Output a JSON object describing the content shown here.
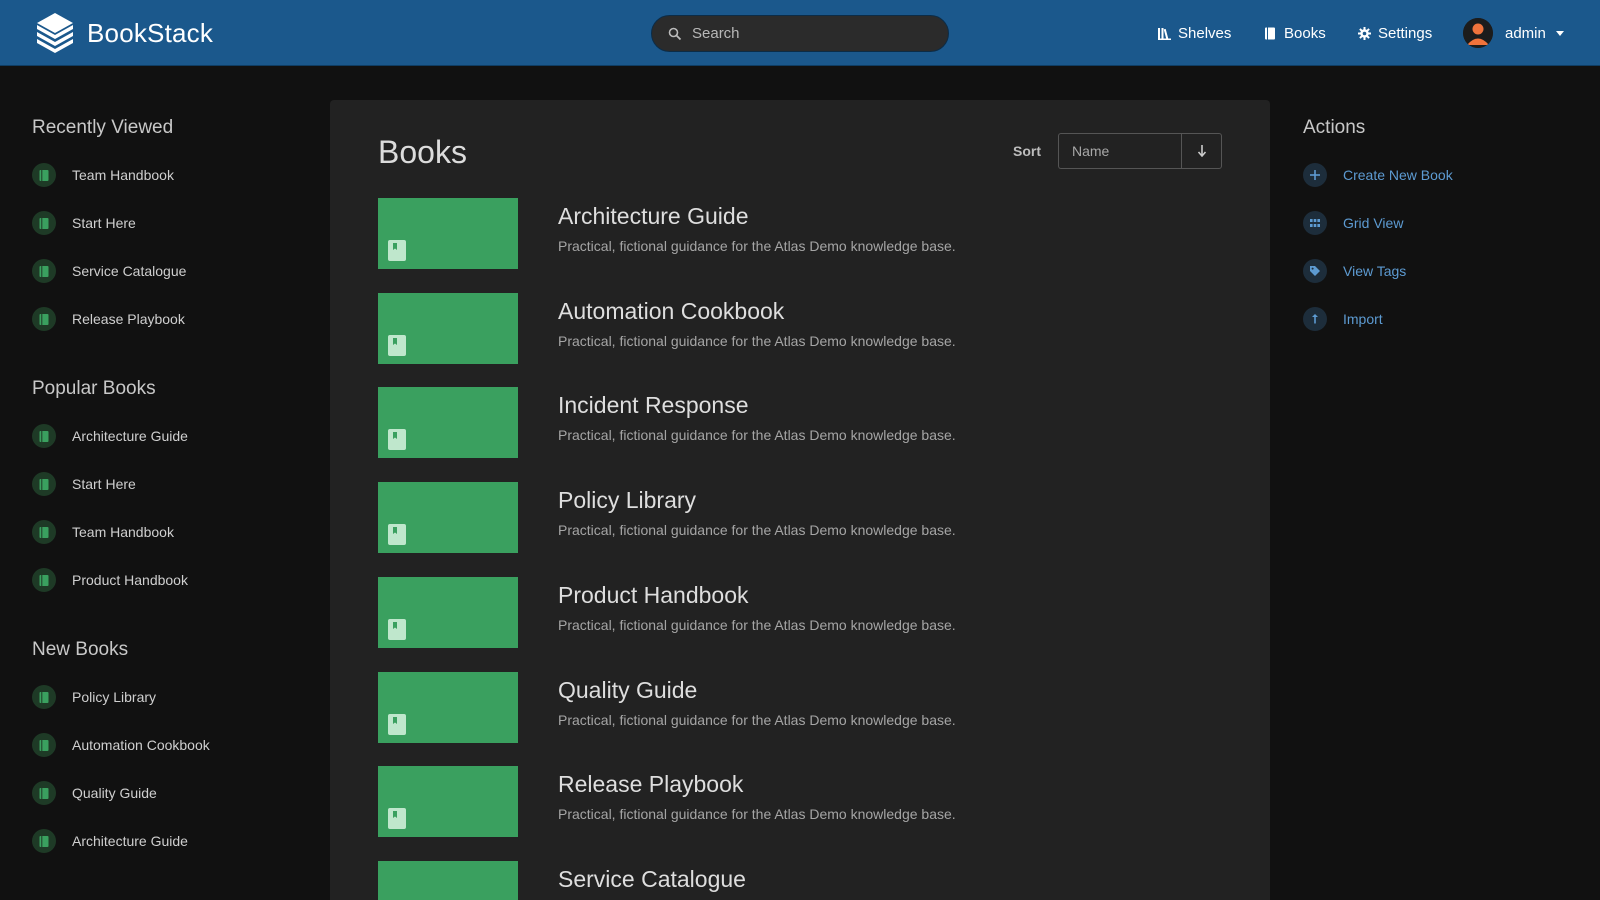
{
  "app": {
    "name": "BookStack"
  },
  "header": {
    "search_placeholder": "Search",
    "nav": [
      {
        "label": "Shelves",
        "icon": "shelves-icon"
      },
      {
        "label": "Books",
        "icon": "book-icon"
      },
      {
        "label": "Settings",
        "icon": "gear-icon"
      }
    ],
    "user": {
      "name": "admin"
    }
  },
  "left_sidebar": {
    "recently_viewed": {
      "title": "Recently Viewed",
      "items": [
        "Team Handbook",
        "Start Here",
        "Service Catalogue",
        "Release Playbook"
      ]
    },
    "popular_books": {
      "title": "Popular Books",
      "items": [
        "Architecture Guide",
        "Start Here",
        "Team Handbook",
        "Product Handbook"
      ]
    },
    "new_books": {
      "title": "New Books",
      "items": [
        "Policy Library",
        "Automation Cookbook",
        "Quality Guide",
        "Architecture Guide"
      ]
    }
  },
  "main": {
    "title": "Books",
    "sort": {
      "label": "Sort",
      "value": "Name"
    },
    "books": [
      {
        "name": "Architecture Guide",
        "description": "Practical, fictional guidance for the Atlas Demo knowledge base."
      },
      {
        "name": "Automation Cookbook",
        "description": "Practical, fictional guidance for the Atlas Demo knowledge base."
      },
      {
        "name": "Incident Response",
        "description": "Practical, fictional guidance for the Atlas Demo knowledge base."
      },
      {
        "name": "Policy Library",
        "description": "Practical, fictional guidance for the Atlas Demo knowledge base."
      },
      {
        "name": "Product Handbook",
        "description": "Practical, fictional guidance for the Atlas Demo knowledge base."
      },
      {
        "name": "Quality Guide",
        "description": "Practical, fictional guidance for the Atlas Demo knowledge base."
      },
      {
        "name": "Release Playbook",
        "description": "Practical, fictional guidance for the Atlas Demo knowledge base."
      },
      {
        "name": "Service Catalogue",
        "description": ""
      }
    ]
  },
  "right_sidebar": {
    "title": "Actions",
    "actions": [
      {
        "label": "Create New Book",
        "icon": "plus-icon"
      },
      {
        "label": "Grid View",
        "icon": "grid-icon"
      },
      {
        "label": "View Tags",
        "icon": "tag-icon"
      },
      {
        "label": "Import",
        "icon": "import-icon"
      }
    ]
  },
  "colors": {
    "header": "#1b588c",
    "book_cover": "#3aa05f",
    "action_link": "#5d9bd2",
    "background": "#111111",
    "card": "#222222"
  }
}
